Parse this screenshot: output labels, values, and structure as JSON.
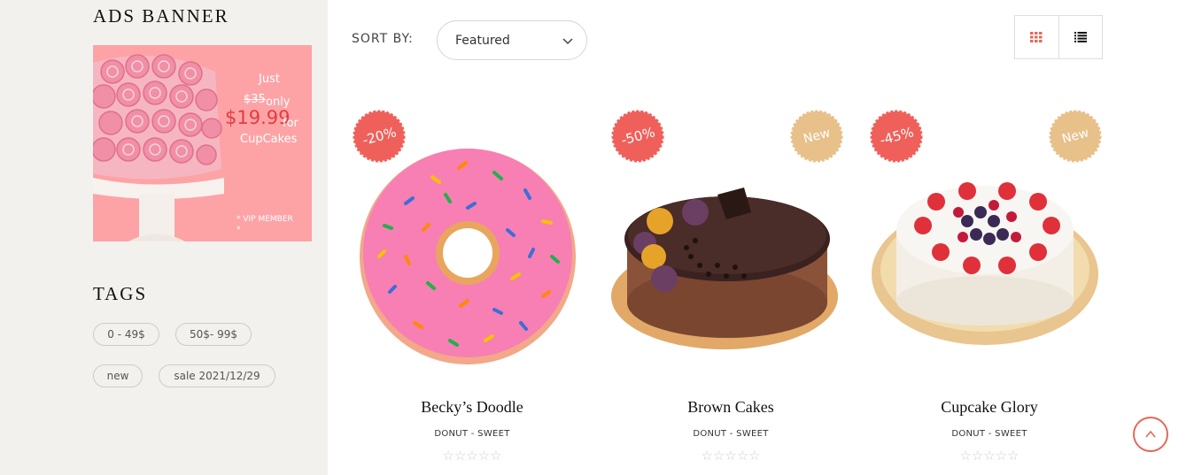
{
  "sidebar": {
    "ads_title": "ADS BANNER",
    "banner": {
      "line1": "Just",
      "old_price": "$35",
      "only": "only",
      "price": "$19.99",
      "for": "for",
      "product": "CupCakes",
      "vip": "* VIP MEMBER *"
    },
    "tags_title": "TAGS",
    "tags": [
      "0 - 49$",
      "50$- 99$",
      "new",
      "sale 2021/12/29"
    ]
  },
  "toolbar": {
    "sort_label": "SORT BY:",
    "sort_value": "Featured",
    "grid_icon": "grid-icon",
    "list_icon": "list-icon"
  },
  "products": [
    {
      "name": "Becky’s Doodle",
      "category": "DONUT - SWEET",
      "discount": "-20%",
      "new_label": "",
      "rating": "☆☆☆☆☆"
    },
    {
      "name": "Brown Cakes",
      "category": "DONUT - SWEET",
      "discount": "-50%",
      "new_label": "New",
      "rating": "☆☆☆☆☆"
    },
    {
      "name": "Cupcake Glory",
      "category": "DONUT - SWEET",
      "discount": "-45%",
      "new_label": "New",
      "rating": "☆☆☆☆☆"
    }
  ],
  "colors": {
    "accent": "#e26a5a",
    "sale_badge": "#f0605a",
    "new_badge": "#e8c08a",
    "banner_bg": "#fda3a6",
    "banner_price": "#e53b3f"
  },
  "scroll_top_icon": "chevron-up-icon"
}
